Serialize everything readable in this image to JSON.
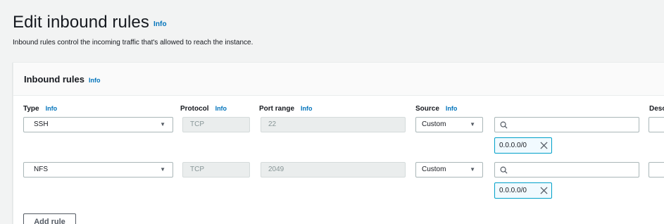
{
  "header": {
    "title": "Edit inbound rules",
    "info": "Info",
    "description": "Inbound rules control the incoming traffic that's allowed to reach the instance."
  },
  "panel": {
    "title": "Inbound rules",
    "info": "Info",
    "columns": {
      "type": "Type",
      "protocol": "Protocol",
      "port_range": "Port range",
      "source": "Source",
      "description": "Desc",
      "info": "Info"
    }
  },
  "rules": [
    {
      "type": "SSH",
      "protocol": "TCP",
      "port_range": "22",
      "source_mode": "Custom",
      "search_value": "",
      "cidr": "0.0.0.0/0"
    },
    {
      "type": "NFS",
      "protocol": "TCP",
      "port_range": "2049",
      "source_mode": "Custom",
      "search_value": "",
      "cidr": "0.0.0.0/0"
    }
  ],
  "actions": {
    "add_rule": "Add rule"
  },
  "colors": {
    "link": "#0073bb",
    "token_border": "#00a1c9",
    "token_bg": "#f1faff"
  }
}
